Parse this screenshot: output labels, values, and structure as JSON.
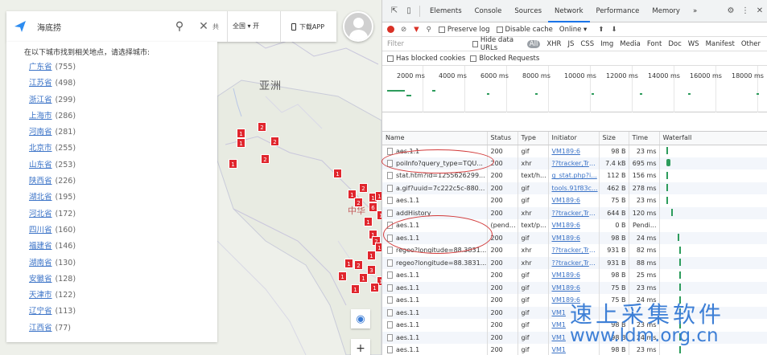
{
  "map": {
    "search_query": "海底捞",
    "search_trunc": "共",
    "region_label": "全国 ▾ 开",
    "download_label": "下载APP",
    "hint": "在以下城市找到相关地点，请选择城市:",
    "provinces": [
      {
        "name": "广东省",
        "count": "(755)"
      },
      {
        "name": "江苏省",
        "count": "(498)"
      },
      {
        "name": "浙江省",
        "count": "(299)"
      },
      {
        "name": "上海市",
        "count": "(286)"
      },
      {
        "name": "河南省",
        "count": "(281)"
      },
      {
        "name": "北京市",
        "count": "(255)"
      },
      {
        "name": "山东省",
        "count": "(253)"
      },
      {
        "name": "陕西省",
        "count": "(226)"
      },
      {
        "name": "湖北省",
        "count": "(195)"
      },
      {
        "name": "河北省",
        "count": "(172)"
      },
      {
        "name": "四川省",
        "count": "(160)"
      },
      {
        "name": "福建省",
        "count": "(146)"
      },
      {
        "name": "湖南省",
        "count": "(130)"
      },
      {
        "name": "安徽省",
        "count": "(128)"
      },
      {
        "name": "天津市",
        "count": "(122)"
      },
      {
        "name": "辽宁省",
        "count": "(113)"
      },
      {
        "name": "江西省",
        "count": "(77)"
      }
    ],
    "continent_label": "亚洲",
    "country_label": "中华",
    "markers": [
      "2",
      "1",
      "2",
      "1",
      "2",
      "1",
      "1",
      "2",
      "1",
      "1",
      "2",
      "1",
      "6",
      "1",
      "1",
      "1",
      "2",
      "1",
      "1",
      "1",
      "2",
      "3",
      "1",
      "1",
      "1",
      "1",
      "1"
    ],
    "zoom_in": "+",
    "accent_color": "#e0262d",
    "link_color": "#3b73c7"
  },
  "devtools": {
    "tabs": [
      "Elements",
      "Console",
      "Sources",
      "Network",
      "Performance",
      "Memory",
      "»"
    ],
    "active_tab": "Network",
    "toolbar": {
      "preserve_log": "Preserve log",
      "disable_cache": "Disable cache",
      "online": "Online",
      "online_caret": "▾"
    },
    "filter": {
      "placeholder": "Filter",
      "hide_data_urls": "Hide data URLs",
      "all": "All",
      "types": [
        "XHR",
        "JS",
        "CSS",
        "Img",
        "Media",
        "Font",
        "Doc",
        "WS",
        "Manifest",
        "Other"
      ],
      "has_blocked_cookies": "Has blocked cookies",
      "blocked_requests": "Blocked Requests"
    },
    "timeline_ticks": [
      "2000 ms",
      "4000 ms",
      "6000 ms",
      "8000 ms",
      "10000 ms",
      "12000 ms",
      "14000 ms",
      "16000 ms",
      "18000 ms"
    ],
    "columns": [
      "Name",
      "Status",
      "Type",
      "Initiator",
      "Size",
      "Time",
      "Waterfall"
    ],
    "rows": [
      {
        "name": "aes.1.1",
        "status": "200",
        "type": "gif",
        "initiator": "VM189:6",
        "size": "98 B",
        "time": "23 ms"
      },
      {
        "name": "poiInfo?query_type=TQU...",
        "status": "200",
        "type": "xhr",
        "initiator": "??tracker,Tra...",
        "size": "7.4 kB",
        "time": "695 ms"
      },
      {
        "name": "stat.htm?id=1255626299...",
        "status": "200",
        "type": "text/h...",
        "initiator": "g_stat.php?i...",
        "size": "112 B",
        "time": "156 ms"
      },
      {
        "name": "a.gif?uuid=7c222c5c-880...",
        "status": "200",
        "type": "gif",
        "initiator": "tools.91f83c...",
        "size": "462 B",
        "time": "278 ms"
      },
      {
        "name": "aes.1.1",
        "status": "200",
        "type": "gif",
        "initiator": "VM189:6",
        "size": "75 B",
        "time": "23 ms"
      },
      {
        "name": "addHistory",
        "status": "200",
        "type": "xhr",
        "initiator": "??tracker,Tra...",
        "size": "644 B",
        "time": "120 ms"
      },
      {
        "name": "aes.1.1",
        "status": "(pendi...",
        "type": "text/p...",
        "initiator": "VM189:6",
        "size": "0 B",
        "time": "Pendi..."
      },
      {
        "name": "aes.1.1",
        "status": "200",
        "type": "gif",
        "initiator": "VM189:6",
        "size": "98 B",
        "time": "24 ms"
      },
      {
        "name": "regeo?longitude=88.3831...",
        "status": "200",
        "type": "xhr",
        "initiator": "??tracker,Tra...",
        "size": "931 B",
        "time": "82 ms"
      },
      {
        "name": "regeo?longitude=88.3831...",
        "status": "200",
        "type": "xhr",
        "initiator": "??tracker,Tra...",
        "size": "931 B",
        "time": "88 ms"
      },
      {
        "name": "aes.1.1",
        "status": "200",
        "type": "gif",
        "initiator": "VM189:6",
        "size": "98 B",
        "time": "25 ms"
      },
      {
        "name": "aes.1.1",
        "status": "200",
        "type": "gif",
        "initiator": "VM189:6",
        "size": "75 B",
        "time": "23 ms"
      },
      {
        "name": "aes.1.1",
        "status": "200",
        "type": "gif",
        "initiator": "VM189:6",
        "size": "75 B",
        "time": "24 ms"
      },
      {
        "name": "aes.1.1",
        "status": "200",
        "type": "gif",
        "initiator": "VM1",
        "size": "",
        "time": ""
      },
      {
        "name": "aes.1.1",
        "status": "200",
        "type": "gif",
        "initiator": "VM1",
        "size": "98 B",
        "time": "23 ms"
      },
      {
        "name": "aes.1.1",
        "status": "200",
        "type": "gif",
        "initiator": "VM1",
        "size": "98 B",
        "time": "24 ms"
      },
      {
        "name": "aes.1.1",
        "status": "200",
        "type": "gif",
        "initiator": "VM1",
        "size": "98 B",
        "time": "23 ms"
      }
    ],
    "waterfall_color": "#2d9c5c",
    "active_color": "#1a73e8",
    "record_color": "#d93025"
  },
  "watermark": {
    "cn": "速上采集软件",
    "url": "www.ldm.org.cn",
    "color": "#3d7fd6"
  }
}
